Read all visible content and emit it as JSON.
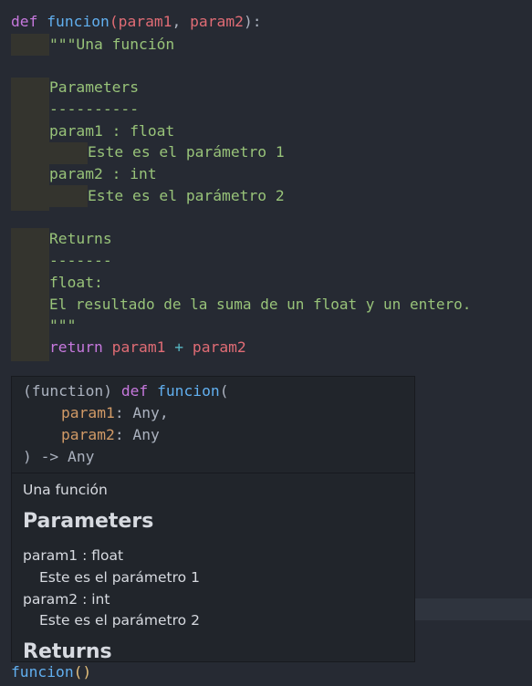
{
  "code": {
    "def_kw": "def",
    "fn_name": "funcion",
    "open_paren": "(",
    "param1": "param1",
    "comma": ", ",
    "param2": "param2",
    "close_sig": "):",
    "doc_open": "\"\"\"Una función",
    "parameters_heading": "Parameters",
    "parameters_rule": "----------",
    "param1_decl": "param1 : float",
    "param1_desc": "Este es el parámetro 1",
    "param2_decl": "param2 : int",
    "param2_desc": "Este es el parámetro 2",
    "returns_heading": "Returns",
    "returns_rule": "-------",
    "return_type": "float:",
    "return_desc": "El resultado de la suma de un float y un entero.",
    "doc_close": "\"\"\"",
    "return_kw": "return",
    "ret_a": "param1",
    "ret_op": "+",
    "ret_b": "param2",
    "call_fn": "funcion",
    "call_parens": "()"
  },
  "hover": {
    "sig_prefix": "(function) ",
    "sig_def": "def",
    "sig_name": "funcion",
    "sig_open": "(",
    "sig_p1": "param1",
    "sig_p1_type": ": Any,",
    "sig_p2": "param2",
    "sig_p2_type": ": Any",
    "sig_close": ") -> Any",
    "summary": "Una función",
    "parameters_heading": "Parameters",
    "param1_decl": "param1 : float",
    "param1_desc": "Este es el parámetro 1",
    "param2_decl": "param2 : int",
    "param2_desc": "Este es el parámetro 2",
    "returns_heading": "Returns"
  },
  "colors": {
    "background": "#262a33",
    "keyword": "#c678dd",
    "function": "#61afef",
    "parameter": "#e06c75",
    "docstring": "#98c379",
    "hover_background": "#21252b"
  }
}
